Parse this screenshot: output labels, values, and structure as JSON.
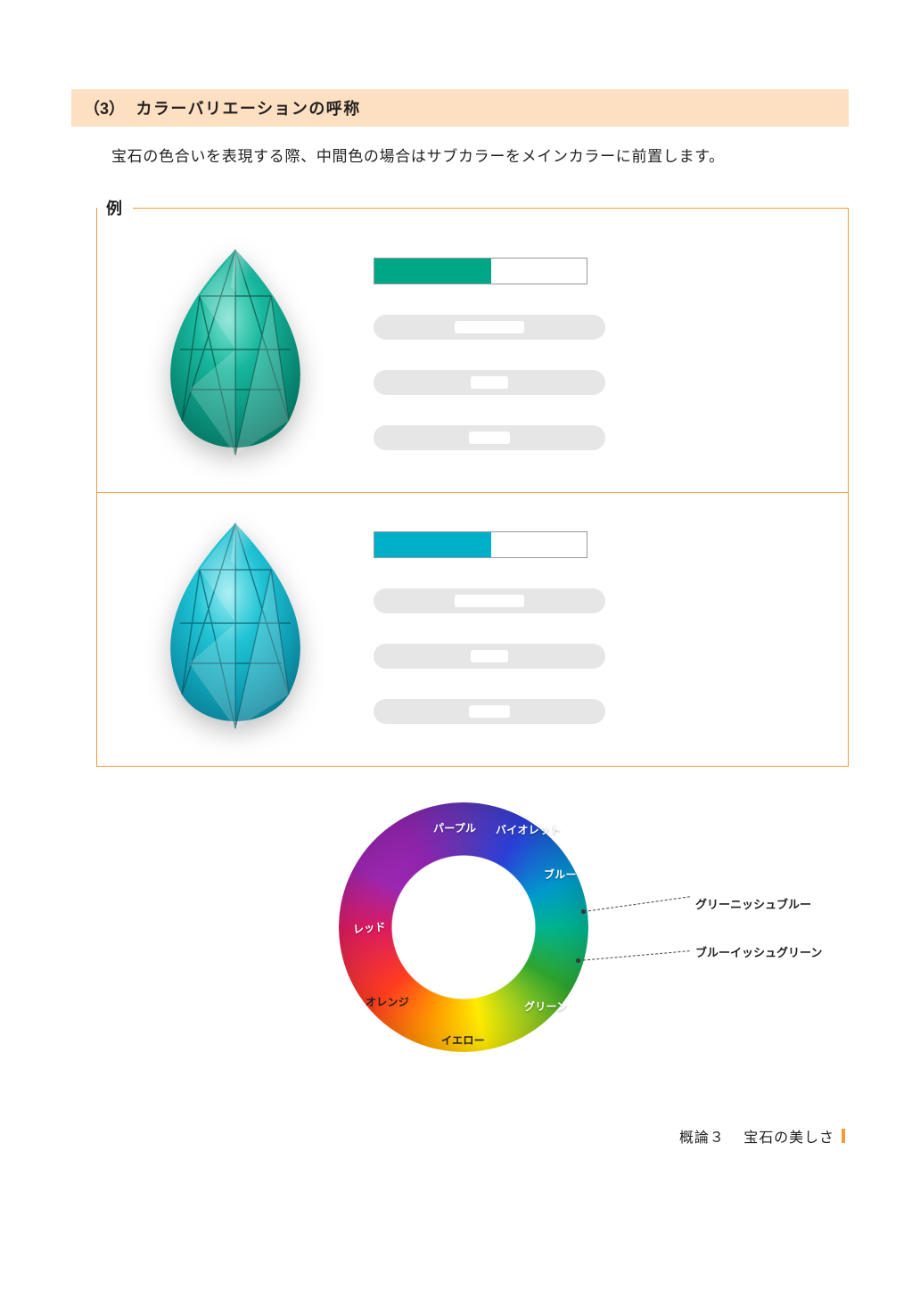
{
  "section": {
    "number": "（3）",
    "title": "カラーバリエーションの呼称"
  },
  "intro": "宝石の色合いを表現する際、中間色の場合はサブカラーをメインカラーに前置します。",
  "example_legend": "例",
  "examples": [
    {
      "gem_color": "bluish-green",
      "swatch_primary": "#00a786"
    },
    {
      "gem_color": "greenish-blue",
      "swatch_primary": "#00b0c8"
    }
  ],
  "wheel_labels": {
    "violet": "バイオレット",
    "blue": "ブルー",
    "green": "グリーン",
    "yellow": "イエロー",
    "orange": "オレンジ",
    "red": "レッド",
    "purple": "パープル"
  },
  "callouts": {
    "greenish_blue": "グリーニッシュブルー",
    "bluish_green": "ブルーイッシュグリーン"
  },
  "footer": {
    "chapter": "概論３",
    "title": "宝石の美しさ"
  }
}
